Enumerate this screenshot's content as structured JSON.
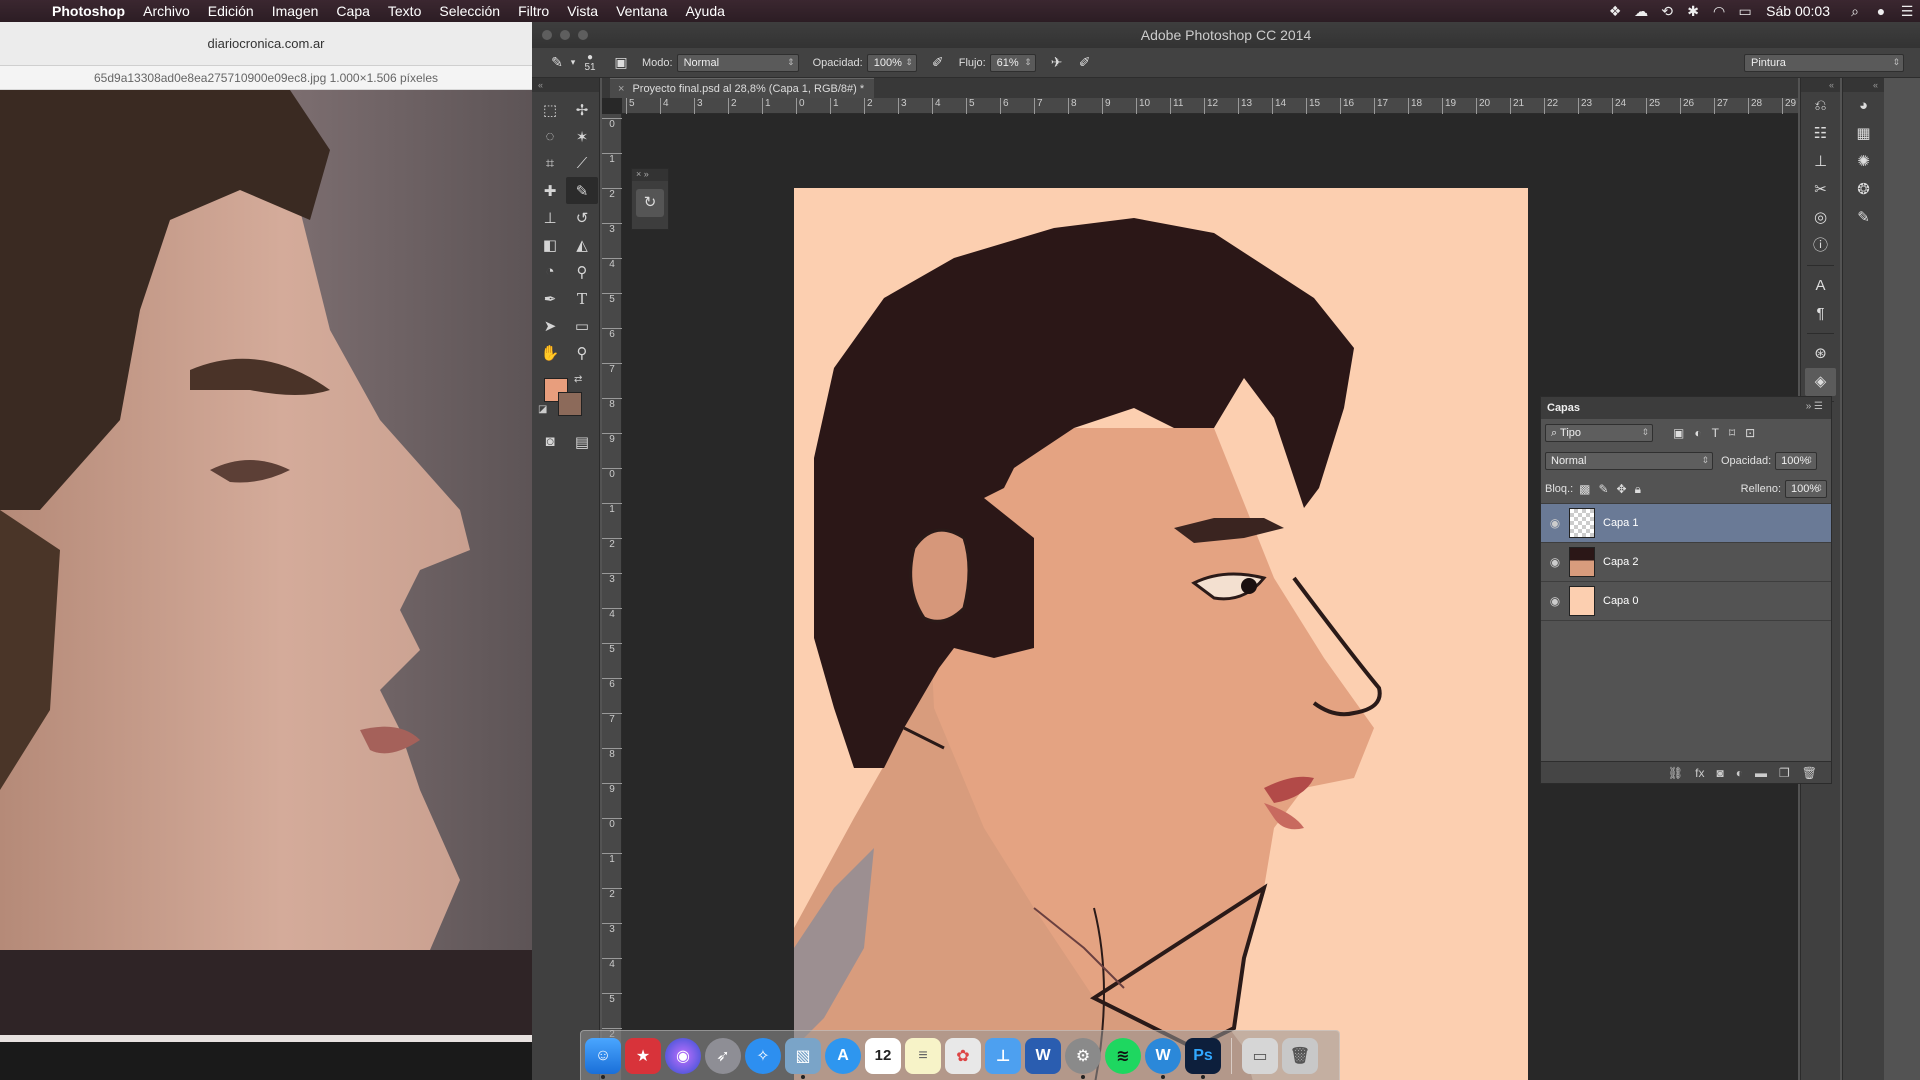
{
  "menubar": {
    "app_name": "Photoshop",
    "items": [
      "Archivo",
      "Edición",
      "Imagen",
      "Capa",
      "Texto",
      "Selección",
      "Filtro",
      "Vista",
      "Ventana",
      "Ayuda"
    ],
    "clock": "Sáb 00:03"
  },
  "preview": {
    "domain": "diariocronica.com.ar",
    "file_info": "65d9a13308ad0e8ea275710900e09ec8.jpg 1.000×1.506 píxeles"
  },
  "ps": {
    "title": "Adobe Photoshop CC 2014",
    "options": {
      "brush_size": "51",
      "mode_label": "Modo:",
      "mode_value": "Normal",
      "opacity_label": "Opacidad:",
      "opacity_value": "100%",
      "flow_label": "Flujo:",
      "flow_value": "61%",
      "workspace": "Pintura"
    },
    "document_tab": "Proyecto final.psd al 28,8% (Capa 1, RGB/8#) *",
    "ruler_h": [
      "5",
      "4",
      "3",
      "2",
      "1",
      "0",
      "1",
      "2",
      "3",
      "4",
      "5",
      "6",
      "7",
      "8",
      "9",
      "10",
      "11",
      "12",
      "13",
      "14",
      "15",
      "16",
      "17",
      "18",
      "19",
      "20",
      "21",
      "22",
      "23",
      "24",
      "25",
      "26",
      "27",
      "28",
      "29"
    ],
    "ruler_v": [
      "0",
      "1",
      "2",
      "3",
      "4",
      "5",
      "6",
      "7",
      "8",
      "9",
      "0",
      "1",
      "2",
      "3",
      "4",
      "5",
      "6",
      "7",
      "8",
      "9",
      "0",
      "1",
      "2",
      "3",
      "4",
      "5",
      "2"
    ],
    "colors": {
      "foreground": "#e89e7d",
      "background": "#8c6a5a",
      "canvas": "#fccfb0"
    }
  },
  "layers_panel": {
    "title": "Capas",
    "filter_value": "Tipo",
    "blend_value": "Normal",
    "opacity_label": "Opacidad:",
    "opacity_value": "100%",
    "lock_label": "Bloq.:",
    "fill_label": "Relleno:",
    "fill_value": "100%",
    "layers": [
      {
        "name": "Capa 1",
        "selected": true
      },
      {
        "name": "Capa 2",
        "selected": false
      },
      {
        "name": "Capa 0",
        "selected": false
      }
    ]
  },
  "dock": {
    "apps": [
      "finder-icon",
      "photo-booth-icon",
      "siri-icon",
      "launchpad-icon",
      "safari-icon",
      "preview-icon",
      "app-store-icon",
      "calendar-icon",
      "notes-icon",
      "photos-icon",
      "keynote-icon",
      "word-icon",
      "system-preferences-icon",
      "spotify-icon",
      "wunderlist-icon",
      "photoshop-icon",
      "downloads-icon",
      "trash-icon"
    ],
    "calendar_day": "12",
    "photoshop_label": "Ps",
    "word_label": "W",
    "wunder_label": "W"
  }
}
